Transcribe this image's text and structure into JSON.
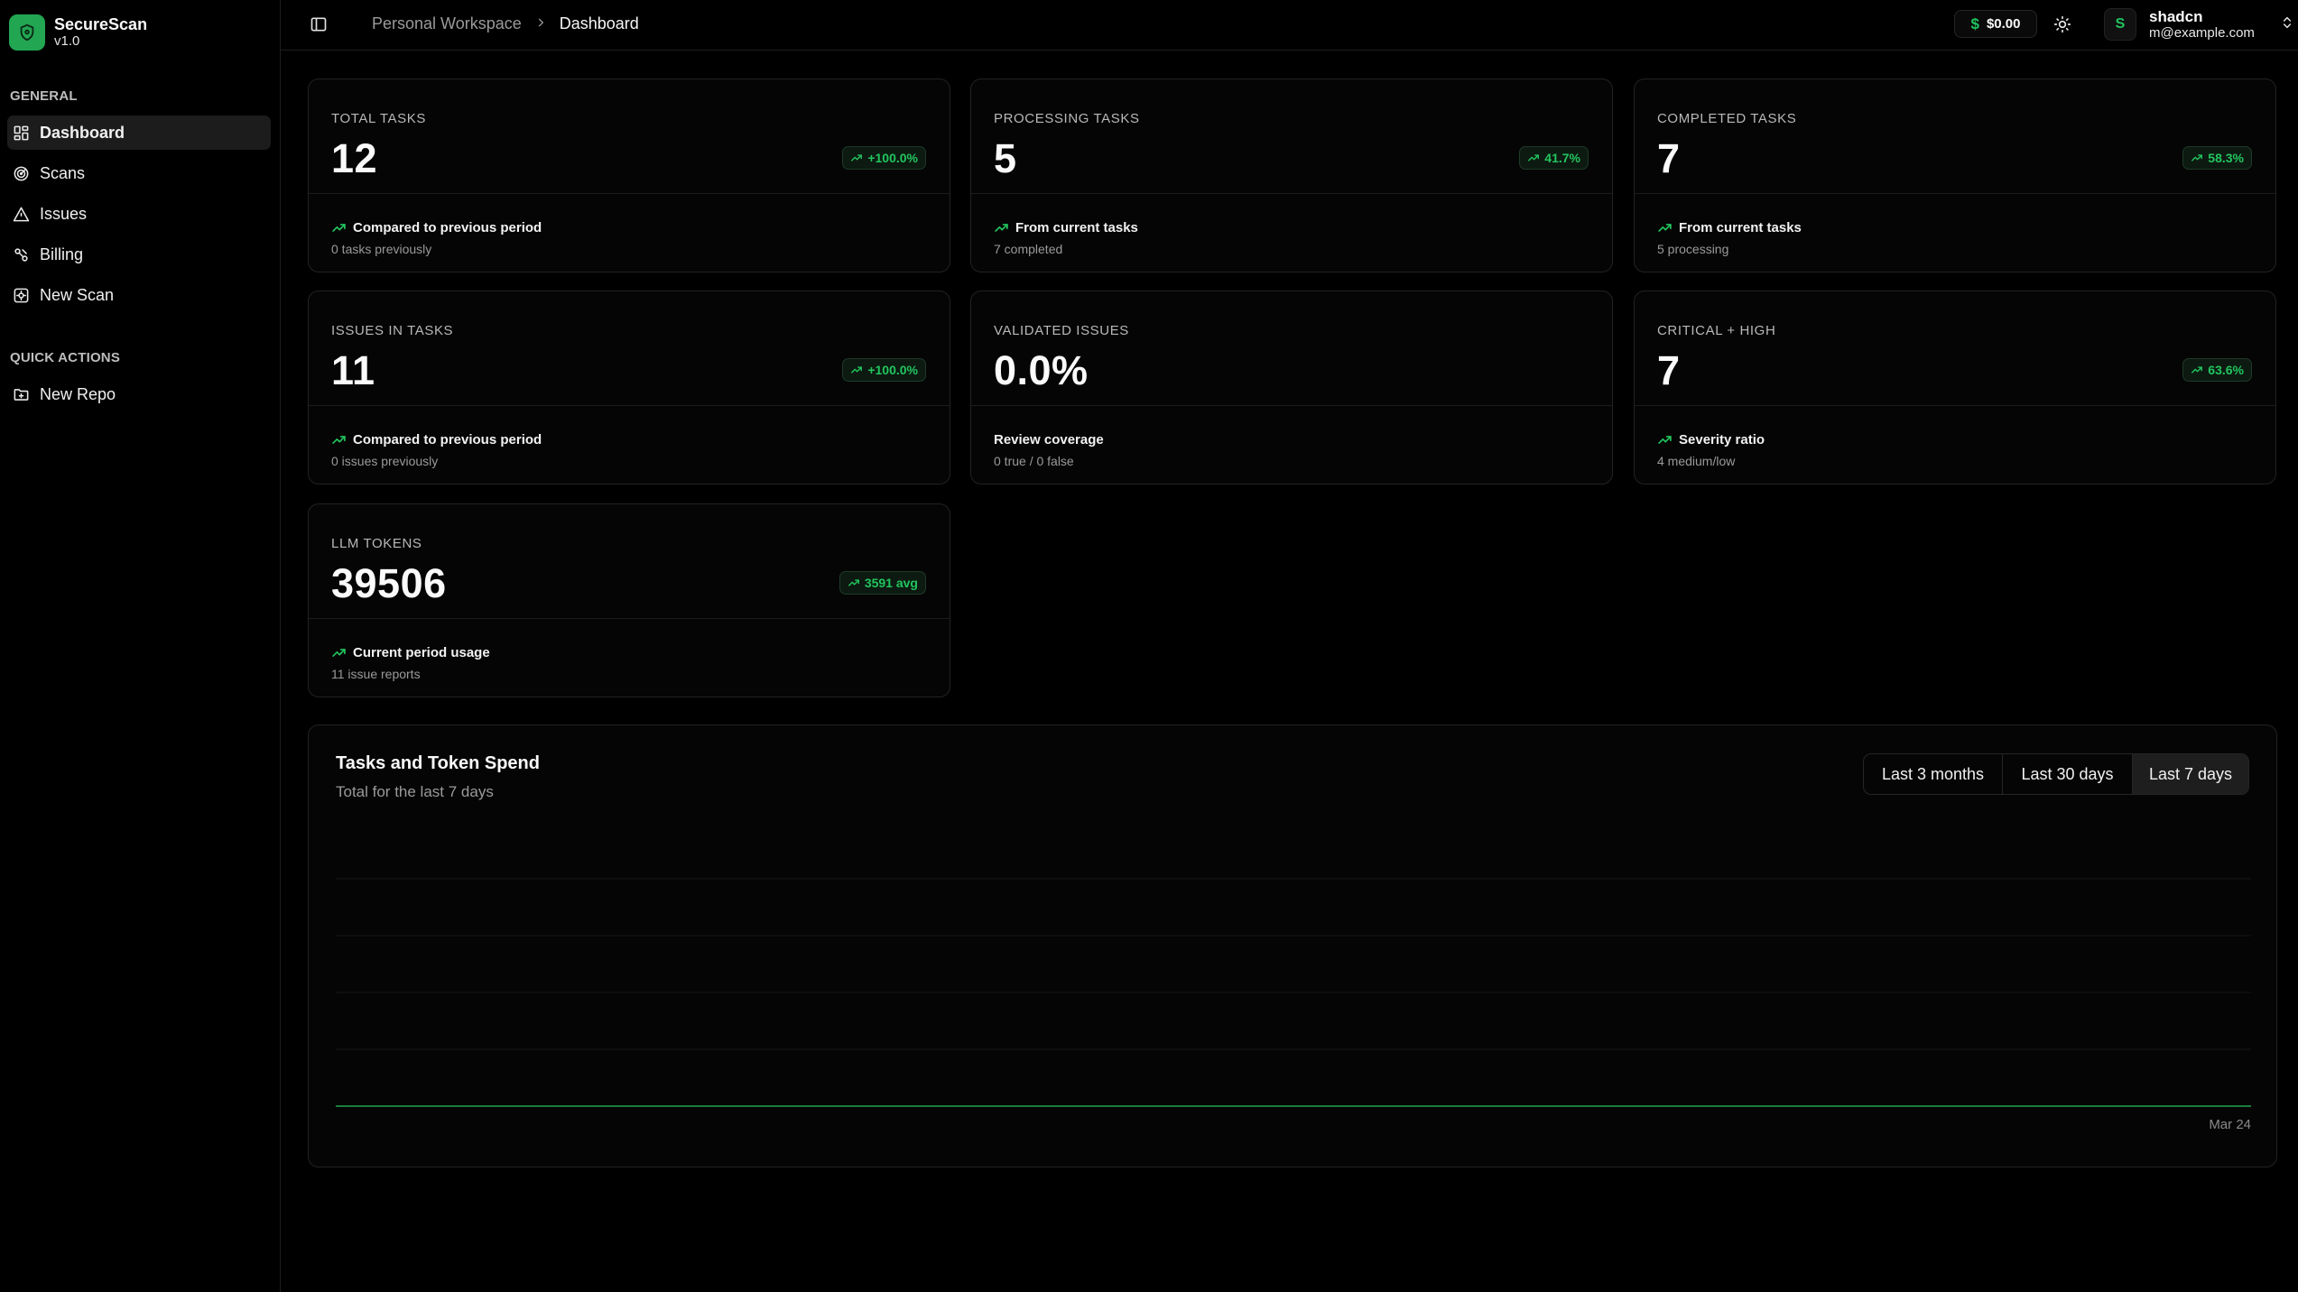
{
  "brand": {
    "name": "SecureScan",
    "version": "v1.0",
    "accent": "#22a652"
  },
  "sidebar": {
    "groups": [
      {
        "label": "General",
        "items": [
          {
            "label": "Dashboard",
            "icon": "layout-grid-icon",
            "active": true
          },
          {
            "label": "Scans",
            "icon": "radar-icon"
          },
          {
            "label": "Issues",
            "icon": "alert-triangle-icon"
          },
          {
            "label": "Billing",
            "icon": "badge-percent-icon"
          },
          {
            "label": "New Scan",
            "icon": "scan-gear-icon"
          }
        ]
      },
      {
        "label": "Quick Actions",
        "items": [
          {
            "label": "New Repo",
            "icon": "folder-plus-icon"
          }
        ]
      }
    ]
  },
  "header": {
    "breadcrumb": [
      "Personal Workspace",
      "Dashboard"
    ],
    "balance": {
      "currency": "$",
      "amount": "$0.00"
    },
    "user": {
      "initial": "S",
      "name": "shadcn",
      "email": "m@example.com"
    }
  },
  "stats": [
    {
      "label": "Total Tasks",
      "value": "12",
      "badge": "+100.0%",
      "foot_title": "Compared to previous period",
      "foot_sub": "0 tasks previously"
    },
    {
      "label": "Processing Tasks",
      "value": "5",
      "badge": "41.7%",
      "foot_title": "From current tasks",
      "foot_sub": "7 completed"
    },
    {
      "label": "Completed Tasks",
      "value": "7",
      "badge": "58.3%",
      "foot_title": "From current tasks",
      "foot_sub": "5 processing"
    },
    {
      "label": "Issues in Tasks",
      "value": "11",
      "badge": "+100.0%",
      "foot_title": "Compared to previous period",
      "foot_sub": "0 issues previously"
    },
    {
      "label": "Validated Issues",
      "value": "0.0%",
      "badge": "",
      "foot_title": "Review coverage",
      "foot_sub": "0 true / 0 false"
    },
    {
      "label": "Critical + High",
      "value": "7",
      "badge": "63.6%",
      "foot_title": "Severity ratio",
      "foot_sub": "4 medium/low"
    },
    {
      "label": "LLM Tokens",
      "value": "39506",
      "badge": "3591 avg",
      "foot_title": "Current period usage",
      "foot_sub": "11 issue reports"
    }
  ],
  "chart_panel": {
    "title": "Tasks and Token Spend",
    "subtitle": "Total for the last 7 days",
    "ranges": [
      "Last 3 months",
      "Last 30 days",
      "Last 7 days"
    ],
    "selected_range": "Last 7 days"
  },
  "chart_data": {
    "type": "area",
    "x": [
      "Mar 24"
    ],
    "series": [],
    "xlabel": "",
    "ylabel": "",
    "grid": true,
    "line_color": "#22a652"
  },
  "colors": {
    "positive": "#22c55e",
    "background": "#000000"
  }
}
